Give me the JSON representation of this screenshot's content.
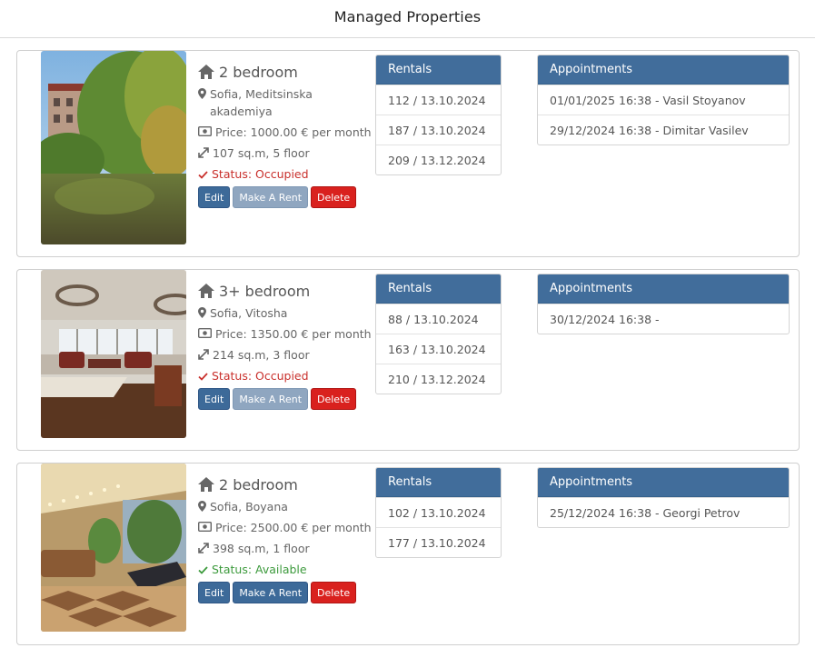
{
  "page": {
    "title": "Managed Properties"
  },
  "buttons": {
    "edit": "Edit",
    "make_rent": "Make A Rent",
    "delete": "Delete"
  },
  "panels": {
    "rentals_title": "Rentals",
    "appointments_title": "Appointments"
  },
  "icons": {
    "home": "home-icon",
    "location": "map-marker-icon",
    "price": "money-icon",
    "size": "resize-icon",
    "status": "check-icon"
  },
  "colors": {
    "accent": "#416d9b",
    "danger": "#d9211e",
    "occupied": "#c9302c",
    "available": "#3c9a3c"
  },
  "properties": [
    {
      "title": "2 bedroom",
      "location": "Sofia, Meditsinska akademiya",
      "price": "Price: 1000.00 € per month",
      "size": "107 sq.m, 5 floor",
      "status": "Status: Occupied",
      "rent_enabled": false,
      "rentals": [
        "112 / 13.10.2024",
        "187 / 13.10.2024",
        "209 / 13.12.2024"
      ],
      "appointments": [
        "01/01/2025 16:38 - Vasil Stoyanov",
        "29/12/2024 16:38 - Dimitar Vasilev"
      ]
    },
    {
      "title": "3+ bedroom",
      "location": "Sofia, Vitosha",
      "price": "Price: 1350.00 € per month",
      "size": "214 sq.m, 3 floor",
      "status": "Status: Occupied",
      "rent_enabled": false,
      "rentals": [
        "88 / 13.10.2024",
        "163 / 13.10.2024",
        "210 / 13.12.2024"
      ],
      "appointments": [
        "30/12/2024 16:38 -"
      ]
    },
    {
      "title": "2 bedroom",
      "location": "Sofia, Boyana",
      "price": "Price: 2500.00 € per month",
      "size": "398 sq.m, 1 floor",
      "status": "Status: Available",
      "rent_enabled": true,
      "rentals": [
        "102 / 13.10.2024",
        "177 / 13.10.2024"
      ],
      "appointments": [
        "25/12/2024 16:38 - Georgi Petrov"
      ]
    }
  ]
}
